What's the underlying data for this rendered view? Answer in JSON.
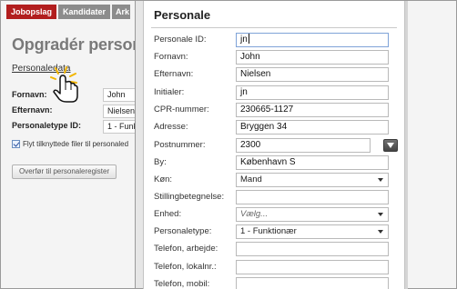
{
  "tabs": [
    {
      "label": "Jobopslag",
      "active": true
    },
    {
      "label": "Kandidater",
      "active": false
    },
    {
      "label": "Ark",
      "active": false
    }
  ],
  "background": {
    "title": "Opgradér person",
    "link_text": "Personaledata",
    "fields": [
      {
        "label": "Fornavn:",
        "value": "John"
      },
      {
        "label": "Efternavn:",
        "value": "Nielsen"
      },
      {
        "label": "Personaletype ID:",
        "value": "1 - Funk"
      }
    ],
    "checkbox_label": "Flyt tilknyttede filer til personaled",
    "checkbox_checked": true,
    "button_label": "Overfør til personaleregister"
  },
  "modal": {
    "title": "Personale",
    "fields": [
      {
        "label": "Personale ID:",
        "value": "jn",
        "type": "text",
        "focused": true
      },
      {
        "label": "Fornavn:",
        "value": "John",
        "type": "text"
      },
      {
        "label": "Efternavn:",
        "value": "Nielsen",
        "type": "text"
      },
      {
        "label": "Initialer:",
        "value": "jn",
        "type": "text"
      },
      {
        "label": "CPR-nummer:",
        "value": "230665-1127",
        "type": "text"
      },
      {
        "label": "Adresse:",
        "value": "Bryggen 34",
        "type": "text"
      },
      {
        "label": "Postnummer:",
        "value": "2300",
        "type": "lookup"
      },
      {
        "label": "By:",
        "value": "København S",
        "type": "text"
      },
      {
        "label": "Køn:",
        "value": "Mand",
        "type": "select"
      },
      {
        "label": "Stillingbetegnelse:",
        "value": "",
        "type": "text"
      },
      {
        "label": "Enhed:",
        "value": "",
        "placeholder": "Vælg...",
        "type": "select"
      },
      {
        "label": "Personaletype:",
        "value": "1 - Funktionær",
        "type": "select"
      },
      {
        "label": "Telefon, arbejde:",
        "value": "",
        "type": "text"
      },
      {
        "label": "Telefon, lokalnr.:",
        "value": "",
        "type": "text"
      },
      {
        "label": "Telefon, mobil:",
        "value": "",
        "type": "text"
      }
    ]
  },
  "colors": {
    "active_tab": "#b21e1e",
    "inactive_tab": "#8c8c8c",
    "focus_border": "#7fa3d8"
  },
  "icons": {
    "cursor": "hand-pointer-icon",
    "lookup": "dropdown-arrow-icon"
  }
}
